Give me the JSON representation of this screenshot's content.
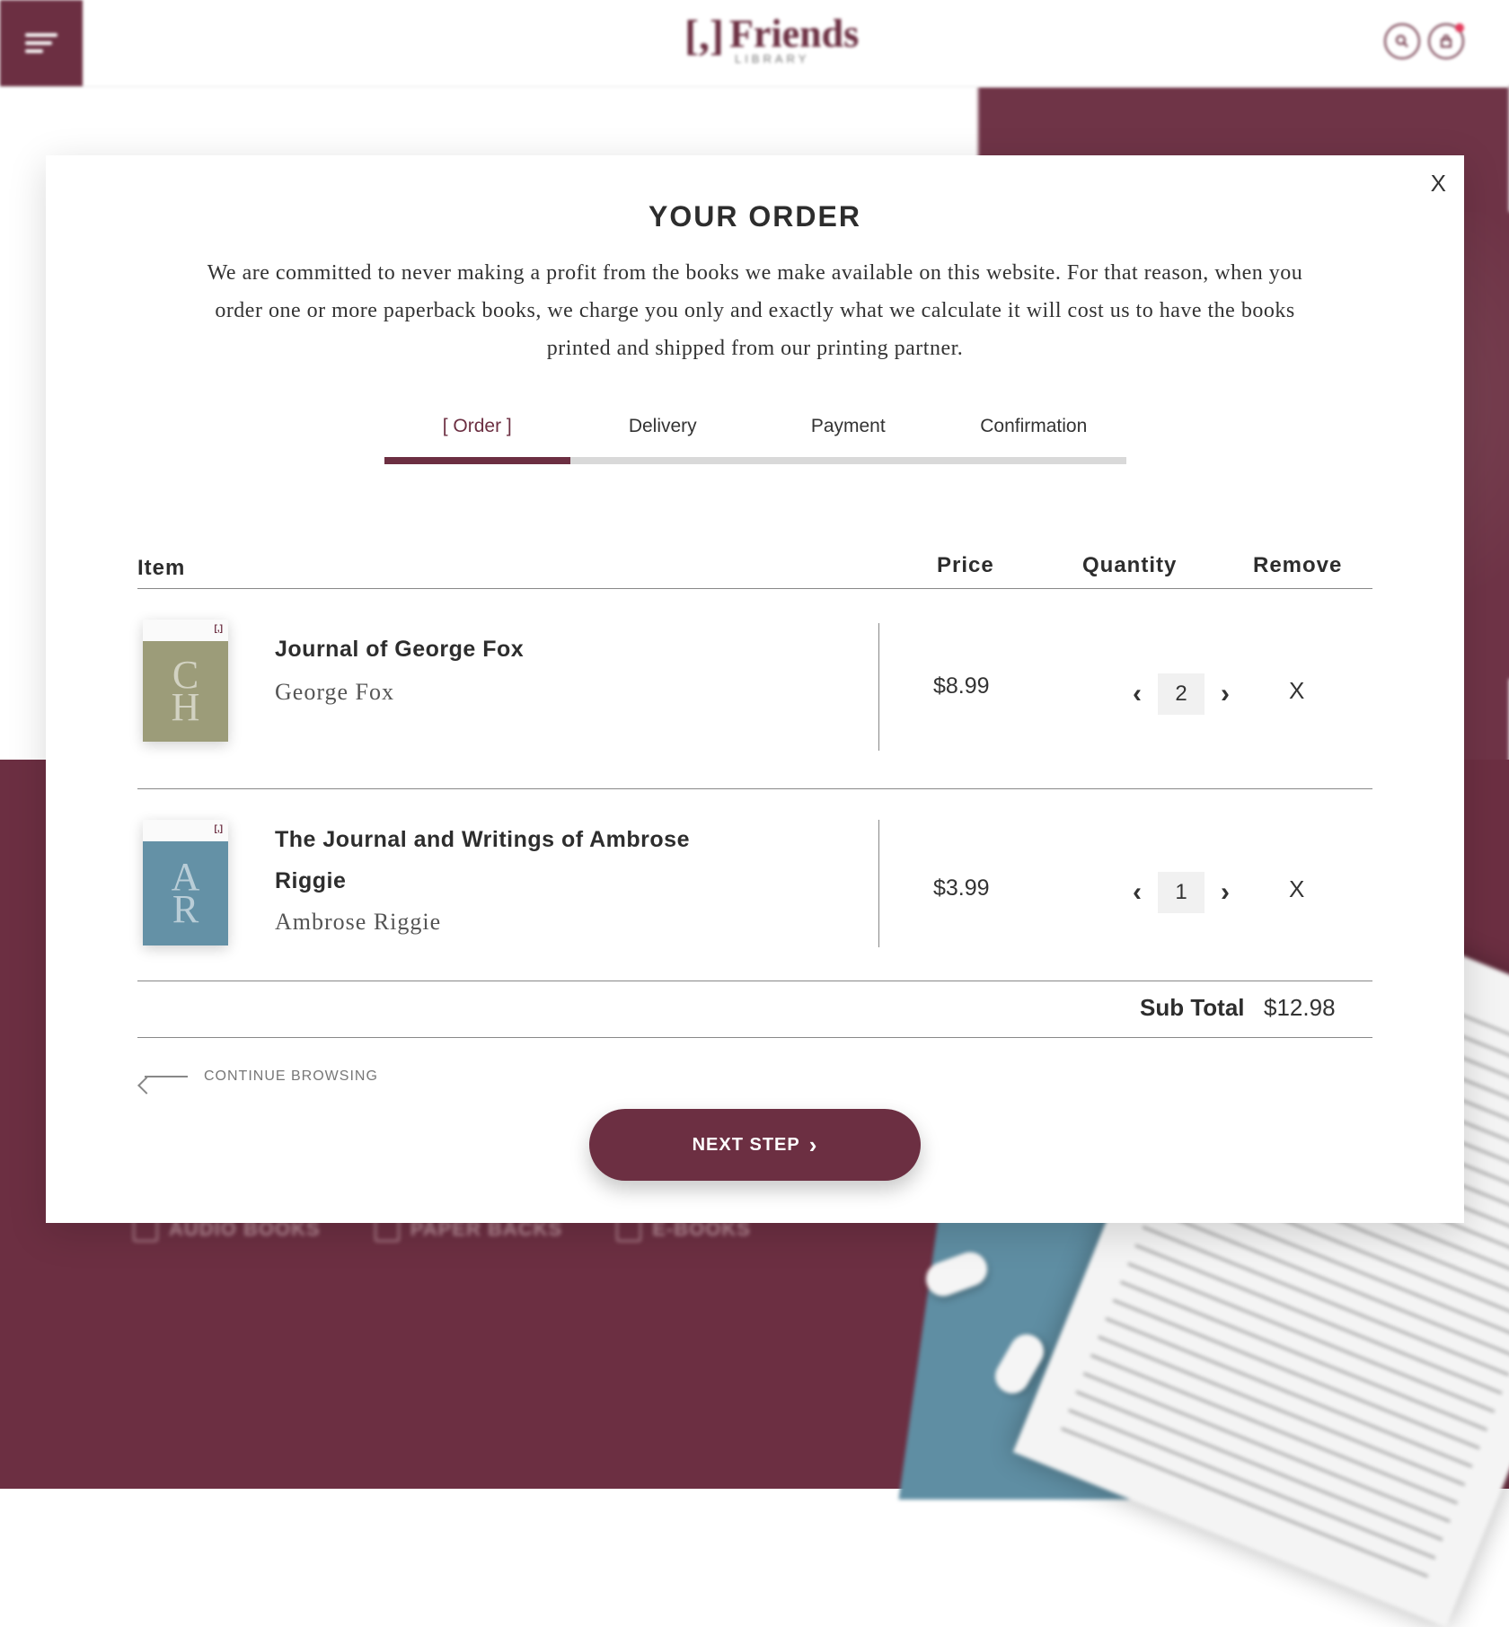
{
  "header": {
    "logo_mark": "[,]",
    "logo_word": "Friends",
    "logo_sub": "LIBRARY",
    "search_icon": "search-icon",
    "cart_icon": "cart-icon"
  },
  "background": {
    "nav_items": [
      "AUDIO BOOKS",
      "PAPER BACKS",
      "E-BOOKS"
    ]
  },
  "modal": {
    "close_label": "X",
    "title": "YOUR ORDER",
    "intro": "We are committed to never making a profit from the books we make available on this website. For that reason, when you order one or more paperback books, we charge you only and exactly what we calculate it will cost us to have the books printed and shipped from our printing partner.",
    "tabs": [
      {
        "label": "[ Order ]",
        "active": true
      },
      {
        "label": "Delivery",
        "active": false
      },
      {
        "label": "Payment",
        "active": false
      },
      {
        "label": "Confirmation",
        "active": false
      }
    ],
    "progress_fraction": 0.25,
    "table": {
      "headers": {
        "item": "Item",
        "price": "Price",
        "quantity": "Quantity",
        "remove": "Remove"
      },
      "rows": [
        {
          "title_line1": "Journal of George Fox",
          "title_line2": "",
          "author": "George Fox",
          "price": "$8.99",
          "quantity": "2",
          "remove": "X",
          "cover_color": "#9c9c79",
          "cover_letters": [
            "C",
            "H"
          ]
        },
        {
          "title_line1": "The Journal and Writings of Ambrose",
          "title_line2": "Riggie",
          "author": "Ambrose Riggie",
          "price": "$3.99",
          "quantity": "1",
          "remove": "X",
          "cover_color": "#6491a6",
          "cover_letters": [
            "A",
            "R"
          ]
        }
      ],
      "subtotal_label": "Sub Total",
      "subtotal_value": "$12.98"
    },
    "continue_label": "CONTINUE BROWSING",
    "next_label": "NEXT STEP",
    "next_chevron": "›"
  },
  "colors": {
    "brand": "#6c2f42",
    "progress_track": "#d9d9d9"
  }
}
